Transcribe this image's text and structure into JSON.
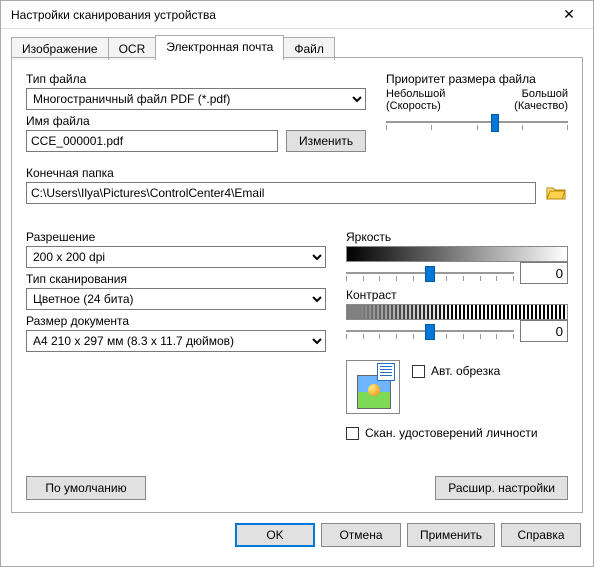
{
  "titlebar": {
    "title": "Настройки сканирования устройства"
  },
  "tabs": {
    "image": "Изображение",
    "ocr": "OCR",
    "email": "Электронная почта",
    "file": "Файл"
  },
  "labels": {
    "file_type": "Тип файла",
    "file_name": "Имя файла",
    "dest_folder": "Конечная папка",
    "resolution": "Разрешение",
    "scan_type": "Тип сканирования",
    "doc_size": "Размер документа",
    "priority_title": "Приоритет размера файла",
    "priority_small": "Небольшой",
    "priority_big": "Большой",
    "priority_speed": "(Скорость)",
    "priority_quality": "(Качество)",
    "brightness": "Яркость",
    "contrast": "Контраст",
    "auto_crop": "Авт. обрезка",
    "id_scan": "Скан. удостоверений личности",
    "change": "Изменить",
    "defaults": "По умолчанию",
    "advanced": "Расшир. настройки",
    "ok": "OK",
    "cancel": "Отмена",
    "apply": "Применить",
    "help": "Справка"
  },
  "values": {
    "file_type": "Многостраничный файл PDF (*.pdf)",
    "file_name": "CCE_000001.pdf",
    "dest_folder": "C:\\Users\\Ilya\\Pictures\\ControlCenter4\\Email",
    "resolution": "200 x 200  dpi",
    "scan_type": "Цветное (24 бита)",
    "doc_size": "А4 210 x 297 мм (8.3 x 11.7 дюймов)",
    "brightness": "0",
    "contrast": "0"
  }
}
